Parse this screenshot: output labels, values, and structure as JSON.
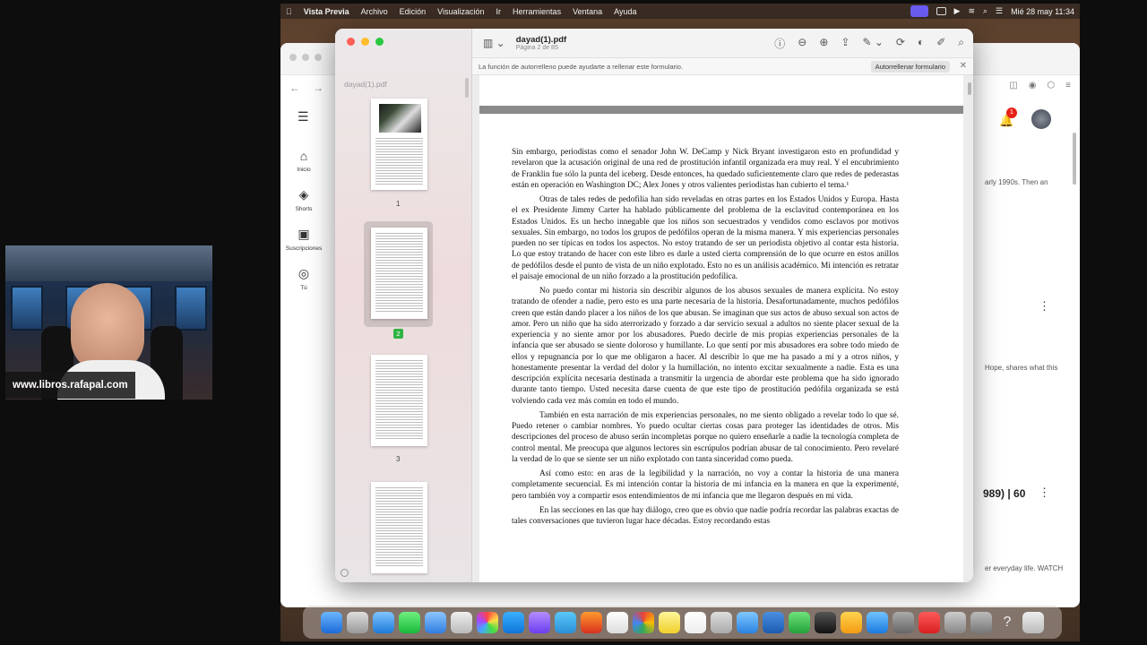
{
  "webcam": {
    "caption": "www.libros.rafapal.com"
  },
  "menubar": {
    "apple": "",
    "app_name": "Vista Previa",
    "items": [
      "Archivo",
      "Edición",
      "Visualización",
      "Ir",
      "Herramientas",
      "Ventana",
      "Ayuda"
    ],
    "datetime": "Mié 28 may 11:34"
  },
  "browser": {
    "sidebar": [
      {
        "icon": "home-icon",
        "glyph": "⌂",
        "label": "Inicio"
      },
      {
        "icon": "shorts-icon",
        "glyph": "◈",
        "label": "Shorts"
      },
      {
        "icon": "subscriptions-icon",
        "glyph": "▣",
        "label": "Suscripciones"
      },
      {
        "icon": "you-icon",
        "glyph": "◎",
        "label": "Tú"
      }
    ],
    "notif_count": "1",
    "snip_1": "arly 1990s. Then an",
    "snip_2": "Hope, shares what this",
    "snip_3": "989) | 60",
    "snip_4": "er everyday life. WATCH"
  },
  "preview": {
    "sidebar_title": "dayad(1).pdf",
    "doc_title": "dayad(1).pdf",
    "doc_subtitle": "Página 2 de 85",
    "pages": [
      "1",
      "2",
      "3"
    ],
    "autofill_message": "La función de autorrelleno puede ayudarte a rellenar este formulario.",
    "autofill_button": "Autorrellenar formulario",
    "paragraphs": [
      "Sin embargo, periodistas como el senador John W. DeCamp y Nick Bryant investigaron esto en profundidad y revelaron que la acusación original de una red de prostitución infantil organizada era muy real. Y el encubrimiento de Franklin fue sólo la punta del iceberg. Desde entonces, ha quedado suficientemente claro que redes de pederastas están en operación en Washington DC; Alex Jones y otros valientes periodistas han cubierto el tema.¹",
      "Otras de tales redes de pedofilia han sido reveladas en otras partes en los Estados Unidos y Europa. Hasta el ex Presidente Jimmy Carter ha hablado públicamente del problema de la esclavitud contemporánea en los Estados Unidos. Es un hecho innegable que los niños son secuestrados y vendidos como esclavos por motivos sexuales. Sin embargo, no todos los grupos de pedófilos operan de la misma manera. Y mis experiencias personales pueden no ser típicas en todos los aspectos. No estoy tratando de ser un periodista objetivo al contar esta historia. Lo que estoy tratando de hacer con este libro es darle a usted cierta comprensión de lo que ocurre en estos anillos de pedófilos desde el punto de vista de un niño explotado. Esto no es un análisis académico. Mi intención es retratar el paisaje emocional de un niño forzado a la prostitución pedofílica.",
      "No puedo contar mi historia sin describir algunos de los abusos sexuales de manera explícita. No estoy tratando de ofender a nadie, pero esto es una parte necesaria de la historia. Desafortunadamente, muchos pedófilos creen que están dando placer a los niños de los que abusan. Se imaginan que sus actos de abuso sexual son actos de amor. Pero un niño que ha sido aterrorizado y forzado a dar servicio sexual a adultos no siente placer sexual de la experiencia y no siente amor por los abusadores. Puedo decirle de mis propias experiencias personales de la infancia que ser abusado se siente doloroso y humillante. Lo que sentí por mis abusadores era sobre todo miedo de ellos y repugnancia por lo que me obligaron a hacer. Al describir lo que me ha pasado a mí y a otros niños, y honestamente presentar la verdad del dolor y la humillación, no intento excitar sexualmente a nadie. Esta es una descripción explícita necesaria destinada a transmitir la urgencia de abordar este problema que ha sido ignorado durante tanto tiempo. Usted necesita darse cuenta de que este tipo de prostitución pedófila organizada se está volviendo cada vez más común en todo el mundo.",
      "También en esta narración de mis experiencias personales, no me siento obligado a revelar todo lo que sé. Puedo retener o cambiar nombres. Yo puedo ocultar ciertas cosas para proteger las identidades de otros. Mis descripciones del proceso de abuso serán incompletas porque no quiero enseñarle a nadie la tecnología completa de control mental. Me preocupa que algunos lectores sin escrúpulos podrían abusar de tal conocimiento. Pero revelaré la verdad de lo que se siente ser un niño explotado con tanta sinceridad como pueda.",
      "Así como esto: en aras de la legibilidad y la narración, no voy a contar la historia de una manera completamente secuencial. Es mi intención contar la historia de mi infancia en la manera en que la experimenté, pero también voy a compartir esos entendimientos de mi infancia que me llegaron después en mi vida.",
      "En las secciones en las que hay diálogo, creo que es obvio que nadie podría recordar las palabras exactas de tales conversaciones que tuvieron lugar hace décadas. Estoy recordando estas"
    ]
  }
}
